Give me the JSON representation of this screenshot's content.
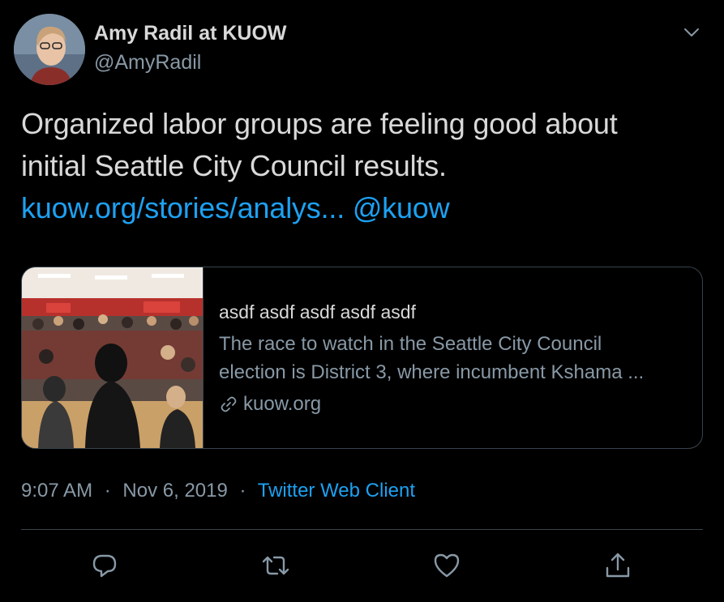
{
  "author": {
    "name": "Amy Radil at KUOW",
    "handle": "@AmyRadil"
  },
  "tweet": {
    "text_lines": [
      "Organized labor groups are feeling good about",
      "initial Seattle City Council results."
    ],
    "link_text": "kuow.org/stories/analys...",
    "mention": "@kuow"
  },
  "card": {
    "title": "asdf asdf asdf asdf asdf",
    "description_lines": [
      "The race to watch in the Seattle City Council",
      "election is District 3, where incumbent Kshama ..."
    ],
    "domain": "kuow.org",
    "domain_icon": "link-icon"
  },
  "meta": {
    "time": "9:07 AM",
    "separator": "·",
    "date": "Nov 6, 2019",
    "client": "Twitter Web Client"
  },
  "actions": {
    "icons": [
      "reply-icon",
      "retweet-icon",
      "like-icon",
      "share-icon"
    ]
  },
  "colors": {
    "background": "#000000",
    "text": "#d9d9d9",
    "secondary": "#8899a6",
    "accent": "#1da1f2",
    "border": "#38444d"
  }
}
